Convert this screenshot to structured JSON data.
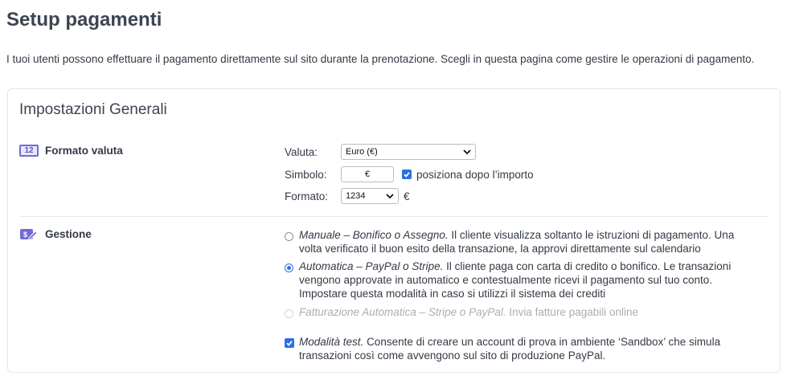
{
  "page": {
    "title": "Setup pagamenti",
    "intro": "I tuoi utenti possono effettuare il pagamento direttamente sul sito durante la prenotazione. Scegli in questa pagina come gestire le operazioni di pagamento."
  },
  "card": {
    "title": "Impostazioni Generali",
    "currency_format": {
      "section_label": "Formato valuta",
      "icon": "calendar-12-icon",
      "icon_text": "12",
      "valuta_label": "Valuta:",
      "valuta_value": "Euro (€)",
      "simbolo_label": "Simbolo:",
      "simbolo_value": "€",
      "after_amount_label": "posiziona dopo l’importo",
      "after_amount_checked": true,
      "formato_label": "Formato:",
      "formato_value": "1234",
      "formato_suffix": "€"
    },
    "management": {
      "section_label": "Gestione",
      "icon": "payment-edit-icon",
      "options": [
        {
          "type": "radio",
          "checked": false,
          "disabled": false,
          "title": "Manuale – Bonifico o Assegno.",
          "desc": "Il cliente visualizza soltanto le istruzioni di pagamento. Una volta verificato il buon esito della transazione, la approvi direttamente sul calendario"
        },
        {
          "type": "radio",
          "checked": true,
          "disabled": false,
          "title": "Automatica – PayPal o Stripe.",
          "desc": "Il cliente paga con carta di credito o bonifico. Le transazioni vengono approvate in automatico e contestualmente ricevi il pagamento sul tuo conto. Impostare questa modalità in caso si utilizzi il sistema dei crediti"
        },
        {
          "type": "radio",
          "checked": false,
          "disabled": true,
          "title": "Fatturazione Automatica – Stripe o PayPal.",
          "desc": "Invia fatture pagabili online"
        },
        {
          "type": "checkbox",
          "checked": true,
          "disabled": false,
          "title": "Modalità test.",
          "desc": "Consente di creare un account di prova in ambiente ‘Sandbox’ che simula transazioni così come avvengono sul sito di produzione PayPal."
        }
      ]
    }
  },
  "colors": {
    "accent": "#2f6fe0",
    "icon_purple": "#6f6bd9",
    "title_text": "#3d4452",
    "disabled_text": "#a9adb4"
  }
}
